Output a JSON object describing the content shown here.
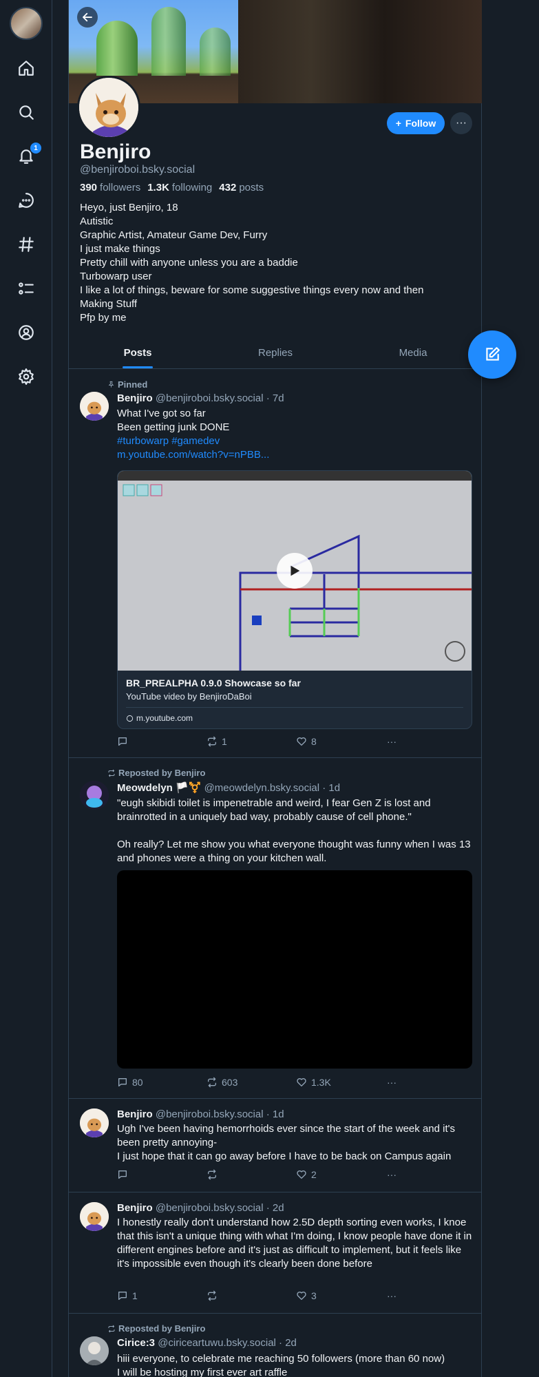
{
  "nav": {
    "notifications_count": "1",
    "items": [
      "home-icon",
      "search-icon",
      "bell-icon",
      "chat-icon",
      "hashtag-icon",
      "list-icon",
      "profile-icon",
      "gear-icon"
    ]
  },
  "profile": {
    "display_name": "Benjiro",
    "handle": "@benjiroboi.bsky.social",
    "followers_count": "390",
    "followers_label": "followers",
    "following_count": "1.3K",
    "following_label": "following",
    "posts_count": "432",
    "posts_label": "posts",
    "follow_label": "Follow",
    "bio": [
      "Heyo, just Benjiro, 18",
      "Autistic",
      "Graphic Artist, Amateur Game Dev, Furry",
      "I just make things",
      "Pretty chill with anyone unless you are a baddie",
      "Turbowarp user",
      "I like a lot of things, beware for some suggestive things every now and then",
      "Making Stuff",
      "Pfp by me"
    ]
  },
  "tabs": [
    {
      "label": "Posts",
      "active": true
    },
    {
      "label": "Replies",
      "active": false
    },
    {
      "label": "Media",
      "active": false
    }
  ],
  "posts": [
    {
      "top_label": "Pinned",
      "author": "Benjiro",
      "handle": "@benjiroboi.bsky.social",
      "time": "· 7d",
      "lines": [
        "What I've got so far",
        "Been getting junk DONE"
      ],
      "tags": "#turbowarp #gamedev",
      "link": "m.youtube.com/watch?v=nPBB...",
      "embed": {
        "title": "BR_PREALPHA 0.9.0 Showcase so far",
        "desc": "YouTube video by BenjiroDaBoi",
        "domain": "m.youtube.com"
      },
      "replies": "",
      "reposts": "1",
      "likes": "8"
    },
    {
      "top_label": "Reposted by Benjiro",
      "author": "Meowdelyn",
      "author_flags": "🏳️⚧️",
      "handle": "@meowdelyn.bsky.social",
      "time": "· 1d",
      "lines": [
        "\"eugh skibidi toilet is impenetrable and weird, I fear Gen Z is lost and brainrotted in a uniquely bad way, probably cause of cell phone.\"",
        "",
        "Oh really? Let me show you what everyone thought was funny when I was 13 and phones were a thing on your kitchen wall."
      ],
      "replies": "80",
      "reposts": "603",
      "likes": "1.3K"
    },
    {
      "author": "Benjiro",
      "handle": "@benjiroboi.bsky.social",
      "time": "· 1d",
      "lines": [
        "Ugh I've been having hemorrhoids ever since the start of the week and it's been pretty annoying-",
        "I just hope that it can go away before I have to be back on Campus again"
      ],
      "replies": "",
      "reposts": "",
      "likes": "2"
    },
    {
      "author": "Benjiro",
      "handle": "@benjiroboi.bsky.social",
      "time": "· 2d",
      "lines": [
        "I honestly really don't understand how 2.5D depth sorting even works, I knoe that this isn't a unique thing with what I'm doing, I know people have done it in different engines before and it's just as difficult to implement, but it feels like it's impossible even though it's clearly been done before"
      ],
      "replies": "1",
      "reposts": "",
      "likes": "3"
    },
    {
      "top_label": "Reposted by Benjiro",
      "author": "Cirice:3",
      "handle": "@ciriceartuwu.bsky.social",
      "time": "· 2d",
      "lines": [
        "hiii everyone, to celebrate me reaching 50 followers (more than 60 now)",
        "I will be hosting my first ever art raffle"
      ]
    }
  ]
}
